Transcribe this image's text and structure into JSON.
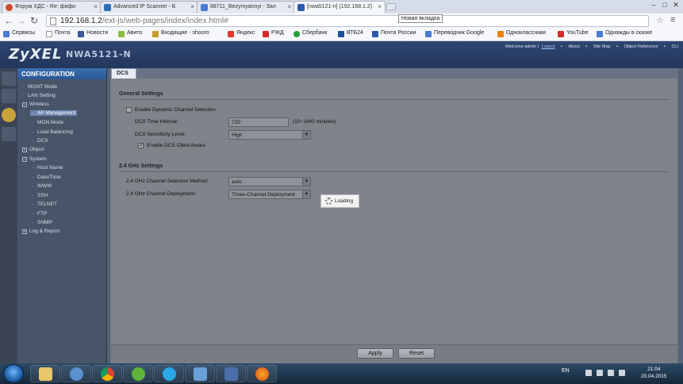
{
  "browser": {
    "tabs": [
      {
        "title": "Форум ХДС - Re: фифи",
        "color": "#d04b2a"
      },
      {
        "title": "Advanced IP Scanner - Б",
        "color": "#2c6db8"
      },
      {
        "title": "88711_Bezymyannyi - Зал",
        "color": "#4a7bd0"
      },
      {
        "title": "[nwa5121-n] (192.168.1.2)",
        "color": "#2a5aa8"
      }
    ],
    "tooltip": "Новая вкладка",
    "url_host": "192.168.1.2",
    "url_path": "/ext-js/web-pages/index/index.html#",
    "bookmarks": [
      {
        "label": "Сервисы",
        "color": "#4a7bd0"
      },
      {
        "label": "Почта",
        "color": "#ffffff"
      },
      {
        "label": "Новости",
        "color": "#3b5998"
      },
      {
        "label": "Авито",
        "color": "#8cbf3f"
      },
      {
        "label": "Входящие - shooro",
        "color": "#c49a2a"
      },
      {
        "label": "Яндекс",
        "color": "#e03a2a"
      },
      {
        "label": "РЖД",
        "color": "#d62a2a"
      },
      {
        "label": "Сбербанк",
        "color": "#21a038"
      },
      {
        "label": "ВТБ24",
        "color": "#1d4fa0"
      },
      {
        "label": "Почта России",
        "color": "#2a5aa8"
      },
      {
        "label": "Переводчик Google",
        "color": "#4a7bd0"
      },
      {
        "label": "Одноклассники",
        "color": "#ee8208"
      },
      {
        "label": "YouTube",
        "color": "#d62a2a"
      },
      {
        "label": "Однажды в сказке",
        "color": "#4a7bd0"
      }
    ]
  },
  "app": {
    "logo": "ZyXEL",
    "model": "NWA5121-N",
    "header_links": {
      "welcome": "Welcome admin |",
      "logout": "Logout",
      "about": "About",
      "sitemap": "Site Map",
      "objref": "Object Reference",
      "cli": "CLI"
    },
    "sidebar": {
      "title": "CONFIGURATION",
      "items": [
        {
          "label": "MGNT Mode",
          "type": "bullet",
          "level": 1
        },
        {
          "label": "LAN Setting",
          "type": "bullet",
          "level": 1
        },
        {
          "label": "Wireless",
          "type": "minus",
          "level": 1
        },
        {
          "label": "AP Management",
          "type": "bullet",
          "level": 2,
          "selected": true
        },
        {
          "label": "MON Mode",
          "type": "bullet",
          "level": 2
        },
        {
          "label": "Load Balancing",
          "type": "bullet",
          "level": 2
        },
        {
          "label": "DCS",
          "type": "bullet",
          "level": 2
        },
        {
          "label": "Object",
          "type": "plus",
          "level": 1
        },
        {
          "label": "System",
          "type": "minus",
          "level": 1
        },
        {
          "label": "Host Name",
          "type": "bullet",
          "level": 2
        },
        {
          "label": "Date/Time",
          "type": "bullet",
          "level": 2
        },
        {
          "label": "WWW",
          "type": "bullet",
          "level": 2
        },
        {
          "label": "SSH",
          "type": "bullet",
          "level": 2
        },
        {
          "label": "TELNET",
          "type": "bullet",
          "level": 2
        },
        {
          "label": "FTP",
          "type": "bullet",
          "level": 2
        },
        {
          "label": "SNMP",
          "type": "bullet",
          "level": 2
        },
        {
          "label": "Log & Report",
          "type": "plus",
          "level": 1
        }
      ]
    },
    "content_tab": "DCS",
    "general": {
      "title": "General Settings",
      "enable_dcs_label": "Enable Dynamic Channel Selection",
      "enable_dcs_checked": false,
      "interval_label": "DCS Time Interval:",
      "interval_value": "720",
      "interval_hint": "(10~1440 minutes)",
      "sensitivity_label": "DCS Sensitivity Level:",
      "sensitivity_value": "High",
      "client_aware_label": "Enable DCS Client Aware",
      "client_aware_checked": true
    },
    "ghz24": {
      "title": "2.4 GHz Settings",
      "method_label": "2.4 GHz Channel Selection Method:",
      "method_value": "auto",
      "deployment_label": "2.4 GHz Channel Deployment:",
      "deployment_value": "Three-Channel Deployment"
    },
    "loading_text": "Loading",
    "apply_label": "Apply",
    "reset_label": "Reset"
  },
  "taskbar": {
    "apps": [
      {
        "name": "explorer",
        "color": "#e8c66a"
      },
      {
        "name": "network",
        "color": "#5a8fd0"
      },
      {
        "name": "chrome",
        "color": "#e0b02a"
      },
      {
        "name": "utorrent",
        "color": "#5fb33a"
      },
      {
        "name": "skype",
        "color": "#2aa8e8"
      },
      {
        "name": "scanner",
        "color": "#6aa0d8"
      },
      {
        "name": "paint",
        "color": "#4a6fa8"
      },
      {
        "name": "firefox",
        "color": "#e26a1a"
      }
    ],
    "lang": "EN",
    "time": "21:04",
    "date": "20.04.2015"
  }
}
